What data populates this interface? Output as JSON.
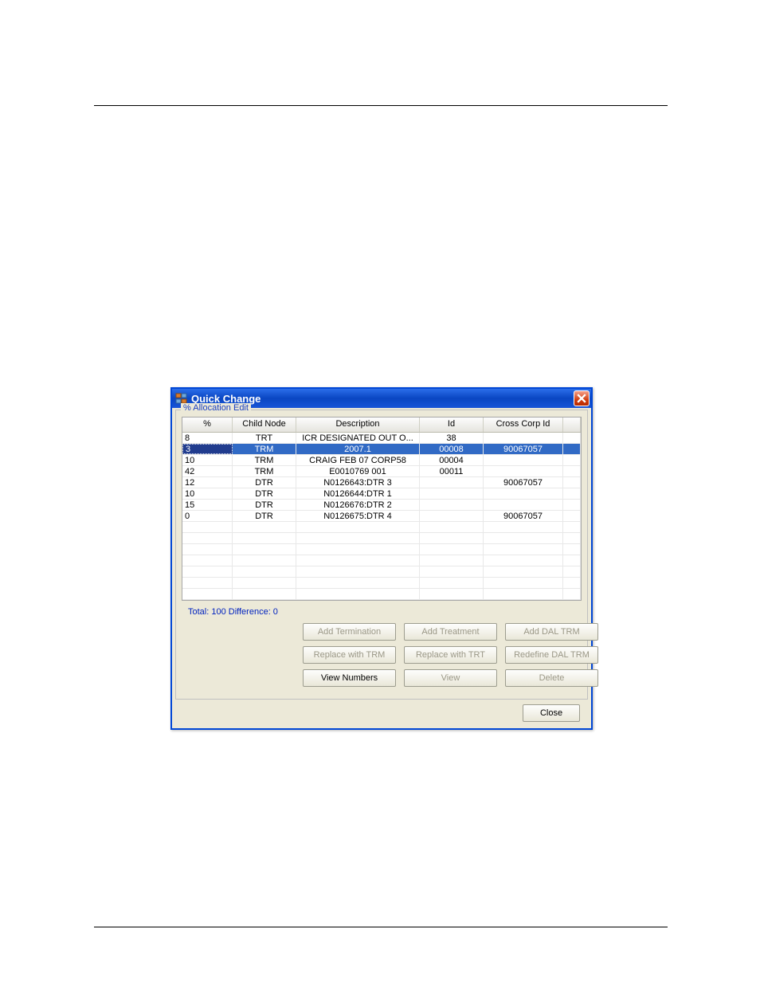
{
  "window": {
    "title": "Quick Change"
  },
  "groupbox": {
    "label": "% Allocation Edit"
  },
  "grid": {
    "headers": {
      "pct": "%",
      "child": "Child Node",
      "desc": "Description",
      "id": "Id",
      "corp": "Cross Corp Id"
    },
    "rows": [
      {
        "pct": "8",
        "child": "TRT",
        "desc": "ICR DESIGNATED OUT O...",
        "id": "38",
        "corp": "",
        "selected": false
      },
      {
        "pct": "3",
        "child": "TRM",
        "desc": "2007.1",
        "id": "00008",
        "corp": "90067057",
        "selected": true
      },
      {
        "pct": "10",
        "child": "TRM",
        "desc": "CRAIG FEB 07 CORP58",
        "id": "00004",
        "corp": "",
        "selected": false
      },
      {
        "pct": "42",
        "child": "TRM",
        "desc": "E0010769 001",
        "id": "00011",
        "corp": "",
        "selected": false
      },
      {
        "pct": "12",
        "child": "DTR",
        "desc": "N0126643:DTR 3",
        "id": "",
        "corp": "90067057",
        "selected": false
      },
      {
        "pct": "10",
        "child": "DTR",
        "desc": "N0126644:DTR 1",
        "id": "",
        "corp": "",
        "selected": false
      },
      {
        "pct": "15",
        "child": "DTR",
        "desc": "N0126676:DTR 2",
        "id": "",
        "corp": "",
        "selected": false
      },
      {
        "pct": "0",
        "child": "DTR",
        "desc": "N0126675:DTR 4",
        "id": "",
        "corp": "90067057",
        "selected": false
      }
    ],
    "empty_rows": 7
  },
  "totals": {
    "text": "Total: 100 Difference: 0"
  },
  "buttons": {
    "add_termination": {
      "label": "Add Termination",
      "enabled": false
    },
    "add_treatment": {
      "label": "Add Treatment",
      "enabled": false
    },
    "add_dal_trm": {
      "label": "Add DAL TRM",
      "enabled": false
    },
    "replace_with_trm": {
      "label": "Replace with TRM",
      "enabled": false
    },
    "replace_with_trt": {
      "label": "Replace with TRT",
      "enabled": false
    },
    "redefine_dal_trm": {
      "label": "Redefine DAL TRM",
      "enabled": false
    },
    "view_numbers": {
      "label": "View Numbers",
      "enabled": true
    },
    "view": {
      "label": "View",
      "enabled": false
    },
    "delete": {
      "label": "Delete",
      "enabled": false
    },
    "close": {
      "label": "Close",
      "enabled": true
    }
  }
}
